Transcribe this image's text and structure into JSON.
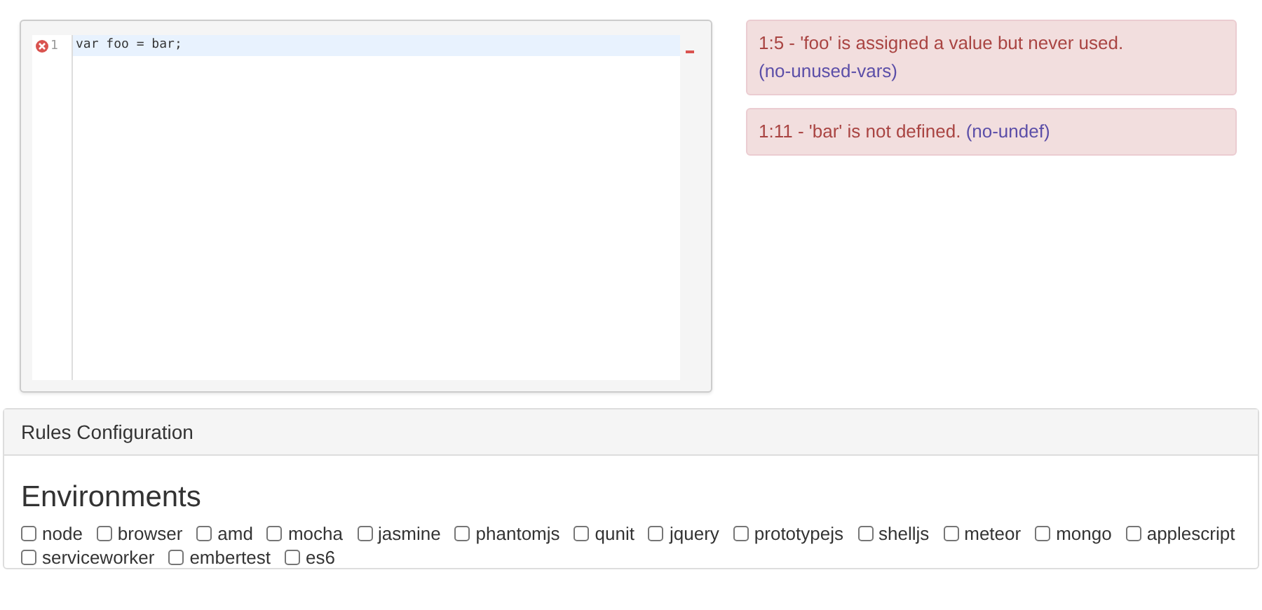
{
  "editor": {
    "lines": [
      {
        "number": "1",
        "error": true,
        "highlighted": true,
        "code": "var foo = bar;"
      }
    ]
  },
  "messages": [
    {
      "text": "1:5 - 'foo' is assigned a value but never used.",
      "rule": "(no-unused-vars)"
    },
    {
      "text": "1:11 - 'bar' is not defined.",
      "rule": "(no-undef)"
    }
  ],
  "panel": {
    "title": "Rules Configuration",
    "section": "Environments",
    "environments": [
      {
        "label": "node",
        "checked": false
      },
      {
        "label": "browser",
        "checked": false
      },
      {
        "label": "amd",
        "checked": false
      },
      {
        "label": "mocha",
        "checked": false
      },
      {
        "label": "jasmine",
        "checked": false
      },
      {
        "label": "phantomjs",
        "checked": false
      },
      {
        "label": "qunit",
        "checked": false
      },
      {
        "label": "jquery",
        "checked": false
      },
      {
        "label": "prototypejs",
        "checked": false
      },
      {
        "label": "shelljs",
        "checked": false
      },
      {
        "label": "meteor",
        "checked": false
      },
      {
        "label": "mongo",
        "checked": false
      },
      {
        "label": "applescript",
        "checked": false
      },
      {
        "label": "serviceworker",
        "checked": false
      },
      {
        "label": "embertest",
        "checked": false
      },
      {
        "label": "es6",
        "checked": false
      }
    ]
  }
}
